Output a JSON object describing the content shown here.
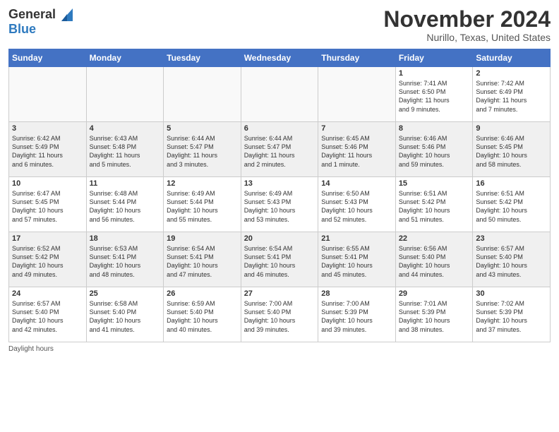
{
  "header": {
    "logo_general": "General",
    "logo_blue": "Blue",
    "month_title": "November 2024",
    "location": "Nurillo, Texas, United States"
  },
  "days_of_week": [
    "Sunday",
    "Monday",
    "Tuesday",
    "Wednesday",
    "Thursday",
    "Friday",
    "Saturday"
  ],
  "weeks": [
    [
      {
        "day": "",
        "info": "",
        "empty": true
      },
      {
        "day": "",
        "info": "",
        "empty": true
      },
      {
        "day": "",
        "info": "",
        "empty": true
      },
      {
        "day": "",
        "info": "",
        "empty": true
      },
      {
        "day": "",
        "info": "",
        "empty": true
      },
      {
        "day": "1",
        "info": "Sunrise: 7:41 AM\nSunset: 6:50 PM\nDaylight: 11 hours\nand 9 minutes."
      },
      {
        "day": "2",
        "info": "Sunrise: 7:42 AM\nSunset: 6:49 PM\nDaylight: 11 hours\nand 7 minutes."
      }
    ],
    [
      {
        "day": "3",
        "info": "Sunrise: 6:42 AM\nSunset: 5:49 PM\nDaylight: 11 hours\nand 6 minutes."
      },
      {
        "day": "4",
        "info": "Sunrise: 6:43 AM\nSunset: 5:48 PM\nDaylight: 11 hours\nand 5 minutes."
      },
      {
        "day": "5",
        "info": "Sunrise: 6:44 AM\nSunset: 5:47 PM\nDaylight: 11 hours\nand 3 minutes."
      },
      {
        "day": "6",
        "info": "Sunrise: 6:44 AM\nSunset: 5:47 PM\nDaylight: 11 hours\nand 2 minutes."
      },
      {
        "day": "7",
        "info": "Sunrise: 6:45 AM\nSunset: 5:46 PM\nDaylight: 11 hours\nand 1 minute."
      },
      {
        "day": "8",
        "info": "Sunrise: 6:46 AM\nSunset: 5:46 PM\nDaylight: 10 hours\nand 59 minutes."
      },
      {
        "day": "9",
        "info": "Sunrise: 6:46 AM\nSunset: 5:45 PM\nDaylight: 10 hours\nand 58 minutes."
      }
    ],
    [
      {
        "day": "10",
        "info": "Sunrise: 6:47 AM\nSunset: 5:45 PM\nDaylight: 10 hours\nand 57 minutes."
      },
      {
        "day": "11",
        "info": "Sunrise: 6:48 AM\nSunset: 5:44 PM\nDaylight: 10 hours\nand 56 minutes."
      },
      {
        "day": "12",
        "info": "Sunrise: 6:49 AM\nSunset: 5:44 PM\nDaylight: 10 hours\nand 55 minutes."
      },
      {
        "day": "13",
        "info": "Sunrise: 6:49 AM\nSunset: 5:43 PM\nDaylight: 10 hours\nand 53 minutes."
      },
      {
        "day": "14",
        "info": "Sunrise: 6:50 AM\nSunset: 5:43 PM\nDaylight: 10 hours\nand 52 minutes."
      },
      {
        "day": "15",
        "info": "Sunrise: 6:51 AM\nSunset: 5:42 PM\nDaylight: 10 hours\nand 51 minutes."
      },
      {
        "day": "16",
        "info": "Sunrise: 6:51 AM\nSunset: 5:42 PM\nDaylight: 10 hours\nand 50 minutes."
      }
    ],
    [
      {
        "day": "17",
        "info": "Sunrise: 6:52 AM\nSunset: 5:42 PM\nDaylight: 10 hours\nand 49 minutes."
      },
      {
        "day": "18",
        "info": "Sunrise: 6:53 AM\nSunset: 5:41 PM\nDaylight: 10 hours\nand 48 minutes."
      },
      {
        "day": "19",
        "info": "Sunrise: 6:54 AM\nSunset: 5:41 PM\nDaylight: 10 hours\nand 47 minutes."
      },
      {
        "day": "20",
        "info": "Sunrise: 6:54 AM\nSunset: 5:41 PM\nDaylight: 10 hours\nand 46 minutes."
      },
      {
        "day": "21",
        "info": "Sunrise: 6:55 AM\nSunset: 5:41 PM\nDaylight: 10 hours\nand 45 minutes."
      },
      {
        "day": "22",
        "info": "Sunrise: 6:56 AM\nSunset: 5:40 PM\nDaylight: 10 hours\nand 44 minutes."
      },
      {
        "day": "23",
        "info": "Sunrise: 6:57 AM\nSunset: 5:40 PM\nDaylight: 10 hours\nand 43 minutes."
      }
    ],
    [
      {
        "day": "24",
        "info": "Sunrise: 6:57 AM\nSunset: 5:40 PM\nDaylight: 10 hours\nand 42 minutes."
      },
      {
        "day": "25",
        "info": "Sunrise: 6:58 AM\nSunset: 5:40 PM\nDaylight: 10 hours\nand 41 minutes."
      },
      {
        "day": "26",
        "info": "Sunrise: 6:59 AM\nSunset: 5:40 PM\nDaylight: 10 hours\nand 40 minutes."
      },
      {
        "day": "27",
        "info": "Sunrise: 7:00 AM\nSunset: 5:40 PM\nDaylight: 10 hours\nand 39 minutes."
      },
      {
        "day": "28",
        "info": "Sunrise: 7:00 AM\nSunset: 5:39 PM\nDaylight: 10 hours\nand 39 minutes."
      },
      {
        "day": "29",
        "info": "Sunrise: 7:01 AM\nSunset: 5:39 PM\nDaylight: 10 hours\nand 38 minutes."
      },
      {
        "day": "30",
        "info": "Sunrise: 7:02 AM\nSunset: 5:39 PM\nDaylight: 10 hours\nand 37 minutes."
      }
    ]
  ],
  "footer": {
    "note": "Daylight hours"
  }
}
